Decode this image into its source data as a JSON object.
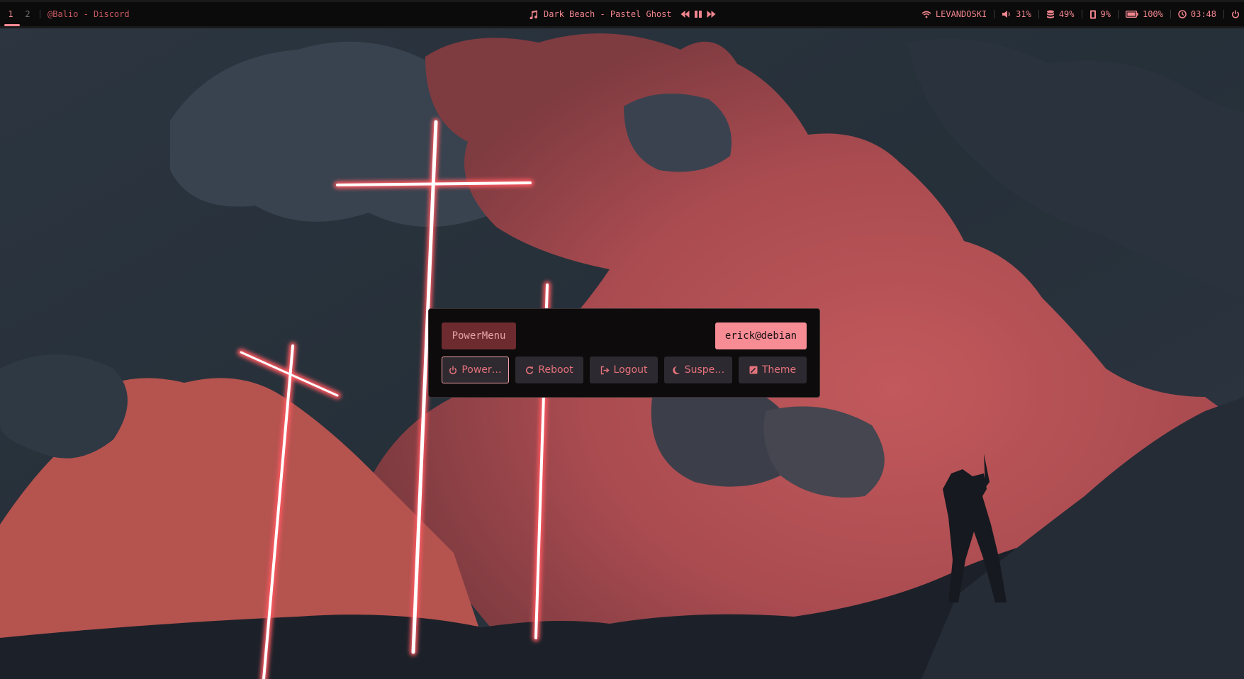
{
  "bar": {
    "workspaces": [
      "1",
      "2"
    ],
    "active_workspace": "1",
    "window_title": "@Balio - Discord",
    "media": {
      "icon": "music-note-icon",
      "track": "Dark Beach - Pastel Ghost"
    },
    "modules": {
      "wifi": {
        "icon": "wifi-icon",
        "label": "LEVANDOSKI"
      },
      "volume": {
        "icon": "volume-icon",
        "label": "31%"
      },
      "disk": {
        "icon": "database-icon",
        "label": "49%"
      },
      "memory": {
        "icon": "memory-icon",
        "label": "9%"
      },
      "battery": {
        "icon": "battery-icon",
        "label": "100%"
      },
      "clock": {
        "icon": "clock-icon",
        "label": "03:48"
      }
    }
  },
  "powermenu": {
    "title": "PowerMenu",
    "user": "erick@debian",
    "actions": [
      {
        "icon": "power-icon",
        "label": "Power…"
      },
      {
        "icon": "reboot-icon",
        "label": "Reboot"
      },
      {
        "icon": "logout-icon",
        "label": "Logout"
      },
      {
        "icon": "moon-icon",
        "label": "Suspe…"
      },
      {
        "icon": "theme-icon",
        "label": "Theme"
      }
    ],
    "selected_action": "Power…"
  },
  "colors": {
    "accent": "#f58a93",
    "bar_bg": "#0b0b0b",
    "menu_bg": "#0d0b0b",
    "title_bg": "#6d2b30",
    "user_bg": "#f78c95",
    "button_bg": "#2d2930"
  }
}
